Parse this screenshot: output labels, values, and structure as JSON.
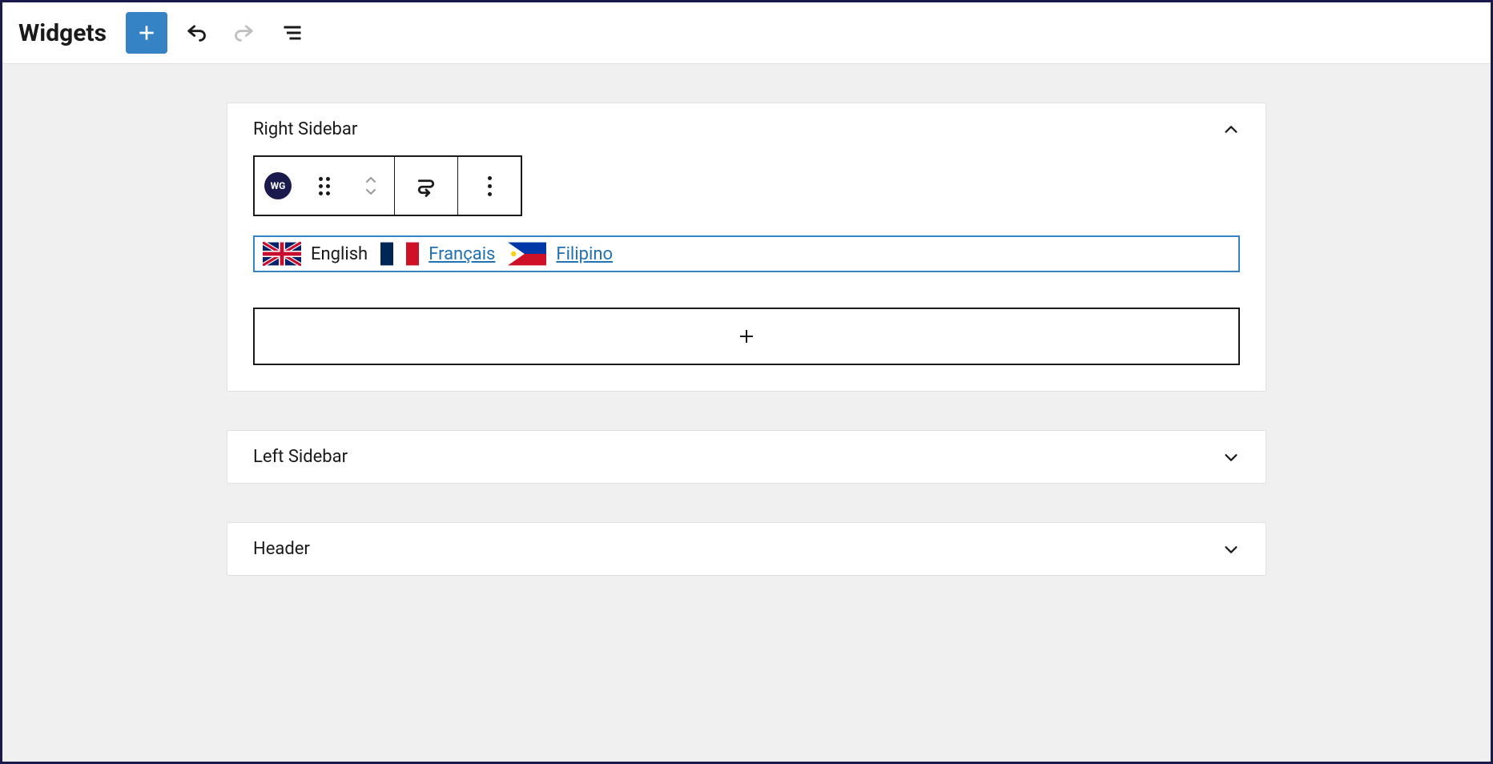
{
  "header": {
    "title": "Widgets"
  },
  "panels": {
    "right_sidebar": {
      "title": "Right Sidebar"
    },
    "left_sidebar": {
      "title": "Left Sidebar"
    },
    "header_area": {
      "title": "Header"
    }
  },
  "block": {
    "icon_label": "WG"
  },
  "languages": {
    "english": "English",
    "francais": "Français",
    "filipino": "Filipino"
  },
  "colors": {
    "accent": "#3582c4",
    "link": "#2271b1"
  }
}
